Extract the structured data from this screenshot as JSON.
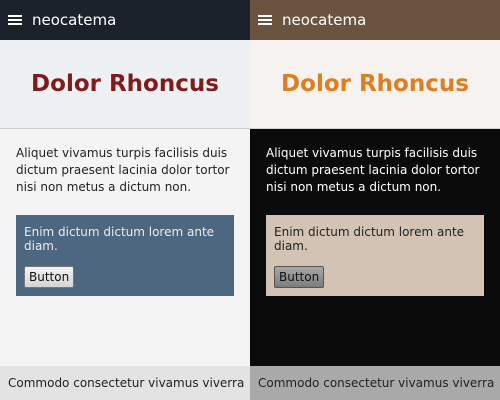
{
  "panes": [
    {
      "theme": "light",
      "app_name": "neocatema",
      "menu_icon": "hamburger-menu-icon",
      "title": "Dolor Rhoncus",
      "body_text": "Aliquet vivamus turpis facilisis duis dictum praesent lacinia dolor tortor nisi non metus a dictum non.",
      "card_text": "Enim dictum dictum lorem ante diam.",
      "button_label": "Button",
      "footer_text": "Commodo consectetur vivamus viverra",
      "colors": {
        "topbar": "#1c222c",
        "title": "#811a1a",
        "card": "#4e6781"
      }
    },
    {
      "theme": "dark",
      "app_name": "neocatema",
      "menu_icon": "hamburger-menu-icon",
      "title": "Dolor Rhoncus",
      "body_text": "Aliquet vivamus turpis facilisis duis dictum praesent lacinia dolor tortor nisi non metus a dictum non.",
      "card_text": "Enim dictum dictum lorem ante diam.",
      "button_label": "Button",
      "footer_text": "Commodo consectetur vivamus viverra",
      "colors": {
        "topbar": "#6a543f",
        "title": "#df7e1e",
        "card": "#d3c3b4"
      }
    }
  ]
}
